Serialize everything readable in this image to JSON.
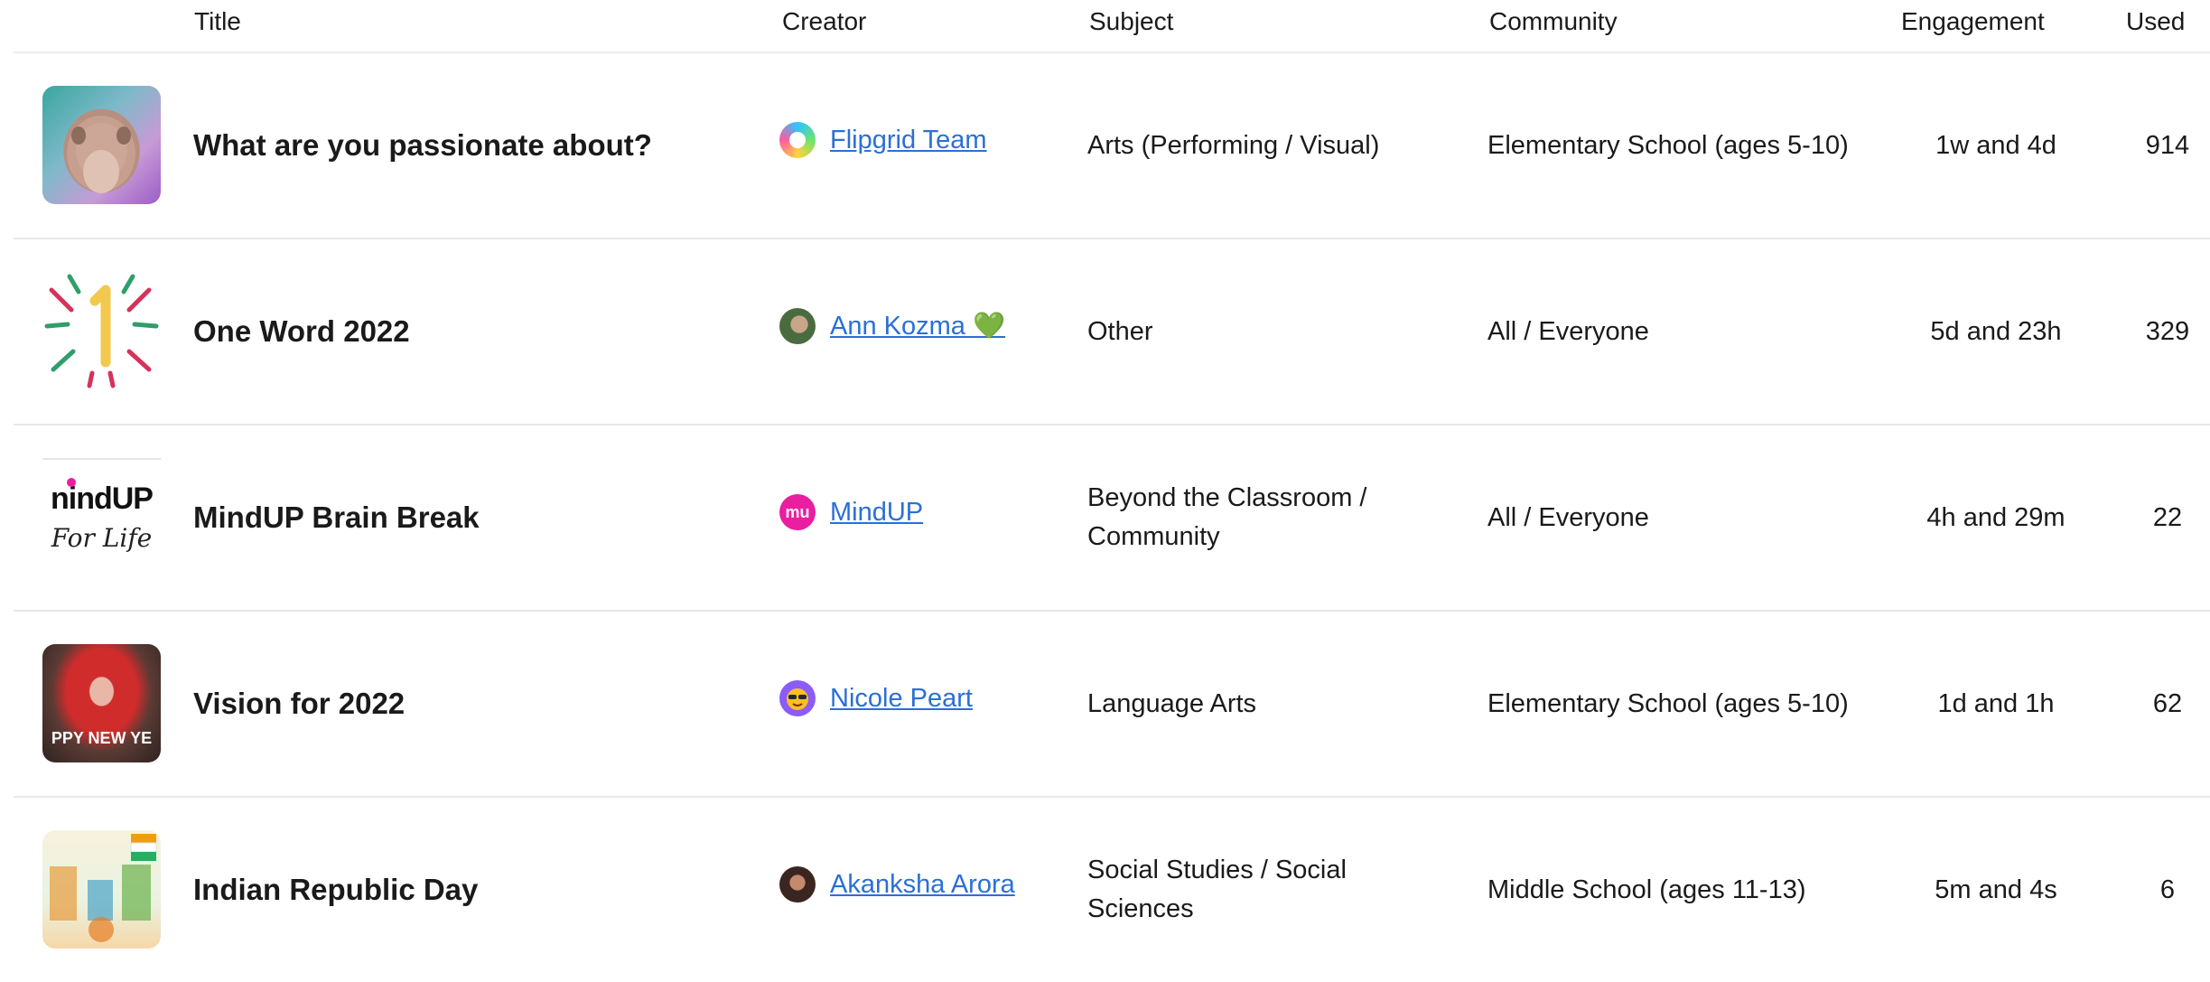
{
  "columns": {
    "title": "Title",
    "creator": "Creator",
    "subject": "Subject",
    "community": "Community",
    "engagement": "Engagement",
    "used": "Used"
  },
  "rows": [
    {
      "title": "What are you passionate about?",
      "creator": "Flipgrid Team",
      "subject": "Arts (Performing / Visual)",
      "community": "Elementary School (ages 5-10)",
      "engagement": "1w and 4d",
      "used": "914"
    },
    {
      "title": "One Word 2022",
      "creator": "Ann Kozma 💚",
      "subject": "Other",
      "community": "All / Everyone",
      "engagement": "5d and 23h",
      "used": "329"
    },
    {
      "title": "MindUP Brain Break",
      "creator": "MindUP",
      "avatar_text": "mu",
      "thumb_text_1": "nindUP",
      "thumb_text_2": "For Life",
      "subject": "Beyond the Classroom / Community",
      "community": "All / Everyone",
      "engagement": "4h and 29m",
      "used": "22"
    },
    {
      "title": "Vision for 2022",
      "creator": "Nicole Peart",
      "thumb_text": "PPY NEW YE",
      "subject": "Language Arts",
      "community": "Elementary School (ages 5-10)",
      "engagement": "1d and 1h",
      "used": "62"
    },
    {
      "title": "Indian Republic Day",
      "creator": "Akanksha Arora",
      "subject": "Social Studies / Social Sciences",
      "community": "Middle School (ages 11-13)",
      "engagement": "5m and 4s",
      "used": "6"
    }
  ],
  "colors": {
    "link": "#2b6fd6",
    "divider": "#e8e8e8",
    "mindup_pink": "#e91ea0"
  }
}
